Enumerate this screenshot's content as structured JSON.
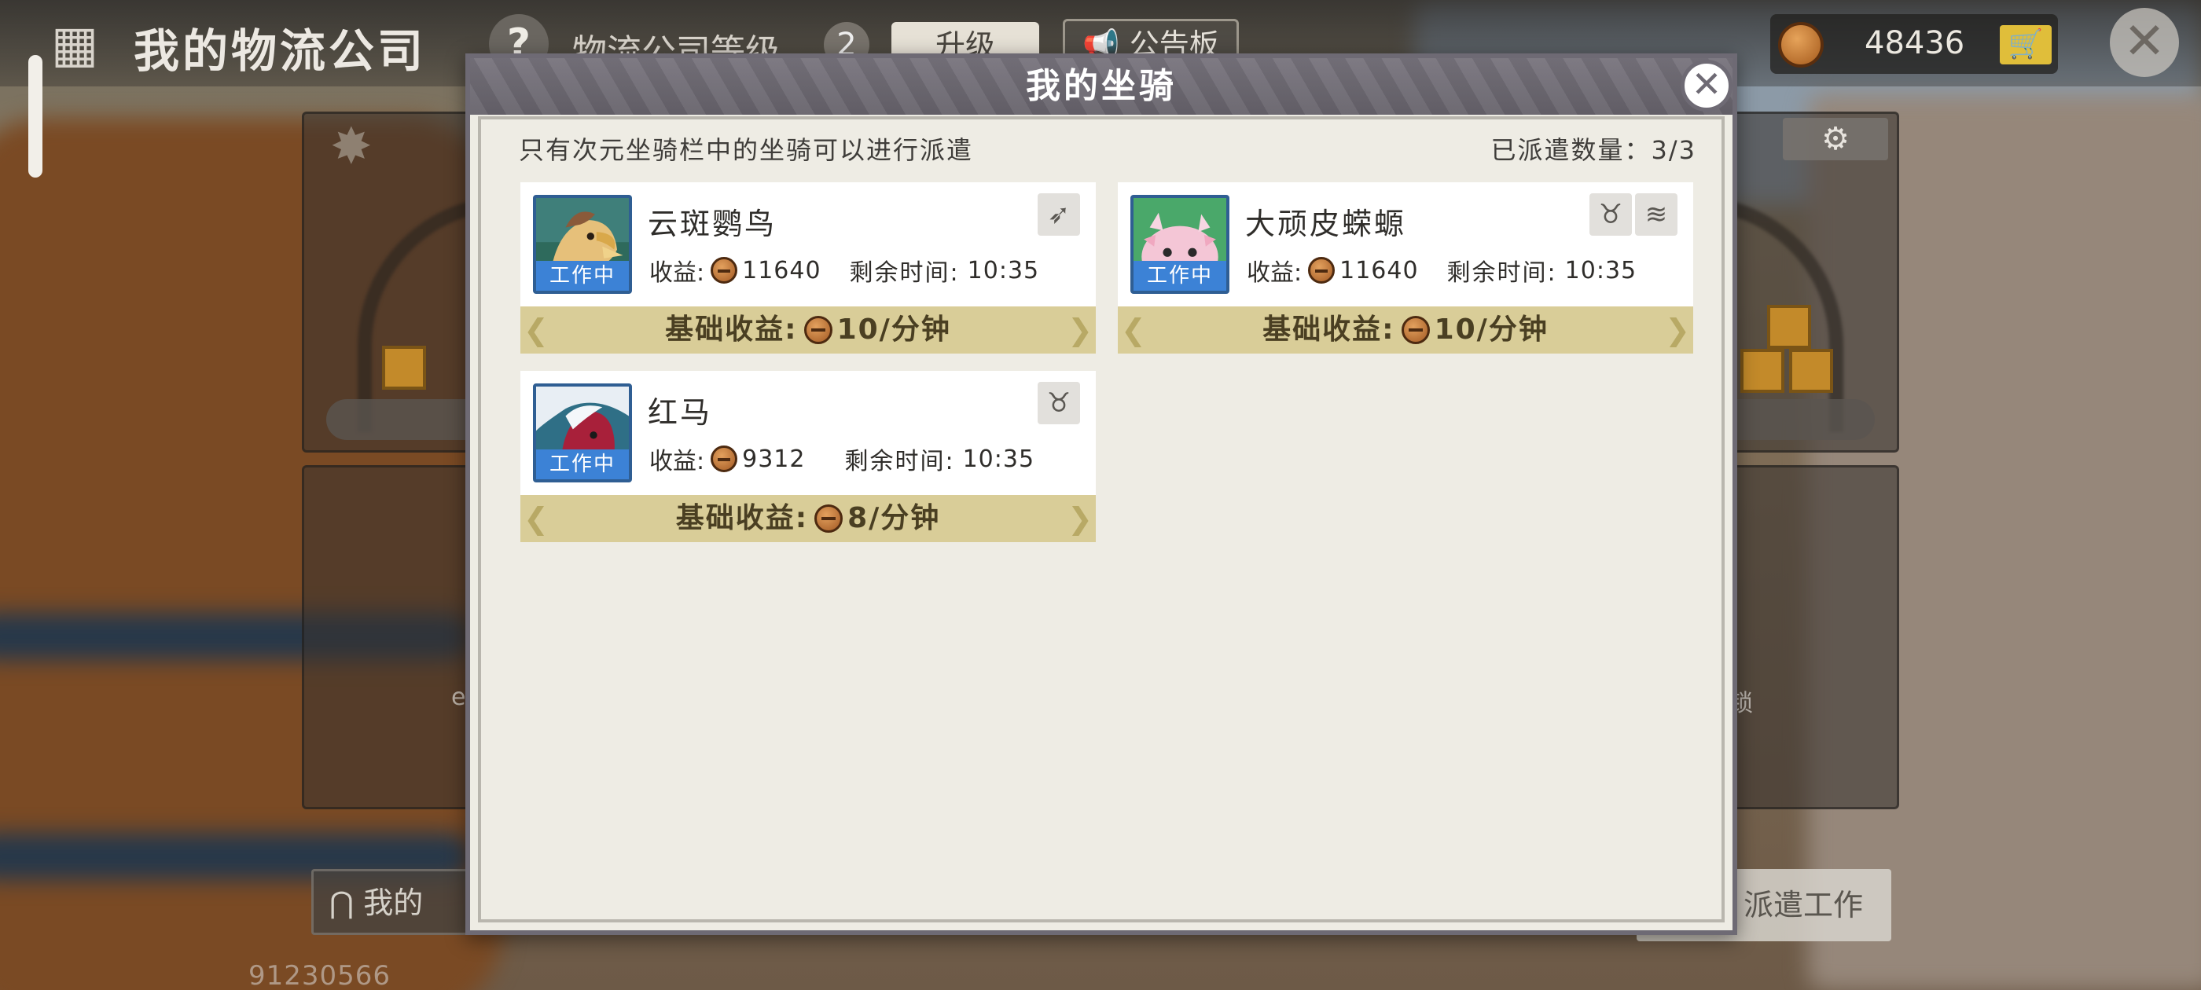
{
  "background": {
    "company_title": "我的物流公司",
    "help_icon": "question-icon",
    "level_label": "物流公司等级",
    "level_value": "2",
    "upgrade_label": "升级",
    "notice_label": "公告板",
    "currency_value": "48436",
    "footer_left_label": "我的",
    "footer_right_label": "派遣工作",
    "footer_id": "91230566",
    "lock_text": "锁",
    "left_char": "e"
  },
  "modal": {
    "title": "我的坐骑",
    "hint": "只有次元坐骑栏中的坐骑可以进行派遣",
    "dispatch_count": "已派遣数量：3/3"
  },
  "mounts": [
    {
      "name": "云斑鹦鸟",
      "status": "工作中",
      "earn_label": "收益:",
      "earn_value": "11640",
      "time_label": "剩余时间:",
      "time_value": "10:35",
      "base_label": "基础收益:",
      "base_value": "10/分钟",
      "traits": [
        "wing-icon"
      ]
    },
    {
      "name": "大顽皮蝾螈",
      "status": "工作中",
      "earn_label": "收益:",
      "earn_value": "11640",
      "time_label": "剩余时间:",
      "time_value": "10:35",
      "base_label": "基础收益:",
      "base_value": "10/分钟",
      "traits": [
        "horns-icon",
        "wave-icon"
      ]
    },
    {
      "name": "红马",
      "status": "工作中",
      "earn_label": "收益:",
      "earn_value": "9312",
      "time_label": "剩余时间:",
      "time_value": "10:35",
      "base_label": "基础收益:",
      "base_value": "8/分钟",
      "traits": [
        "horns-icon"
      ]
    }
  ],
  "colors": {
    "work_tag": "#3c82d6",
    "base_bar": "#d9cd98",
    "modal_header": "#6e6a74",
    "modal_body": "#eeece4"
  }
}
